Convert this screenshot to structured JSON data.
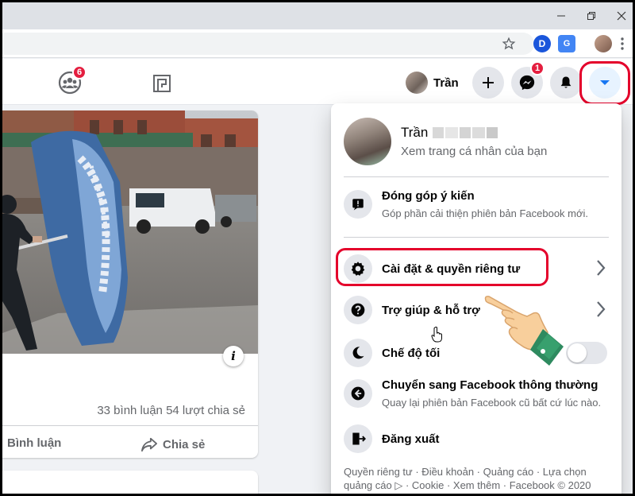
{
  "header": {
    "groups_badge": "6",
    "messenger_badge": "1",
    "profile_name": "Trần"
  },
  "post": {
    "stats": "33 bình luận  54 lượt chia sẻ",
    "comment_label": "Bình luận",
    "share_label": "Chia sẻ"
  },
  "menu": {
    "profile_name": "Trần",
    "profile_sub": "Xem trang cá nhân của bạn",
    "feedback_label": "Đóng góp ý kiến",
    "feedback_sub": "Góp phần cải thiện phiên bản Facebook mới.",
    "settings_label": "Cài đặt & quyền riêng tư",
    "help_label": "Trợ giúp & hỗ trợ",
    "dark_label": "Chế độ tối",
    "dark_mode_on": false,
    "classic_label": "Chuyển sang Facebook thông thường",
    "classic_sub": "Quay lại phiên bản Facebook cũ bất cứ lúc nào.",
    "logout_label": "Đăng xuất",
    "footer_line1": "Quyền riêng tư · Điều khoản · Quảng cáo · Lựa chọn",
    "footer_line2": "quảng cáo ▷ · Cookie · Xem thêm · Facebook © 2020"
  },
  "colors": {
    "accent_blue": "#1877f2",
    "highlight_red": "#e4002b",
    "badge_red": "#e41e3f"
  }
}
